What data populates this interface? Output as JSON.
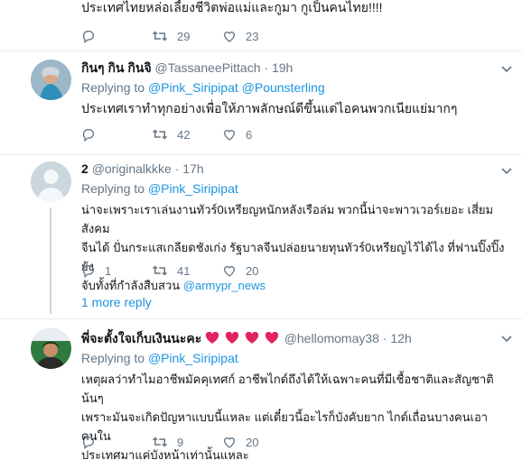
{
  "tweets": [
    {
      "text": "ประเทศไทยหล่อเลี้ยงชีวิตพ่อแม่และกูมา กูเป็นคนไทย!!!!",
      "retweets": "29",
      "likes": "23"
    },
    {
      "name": "กินๆ กิน กินจิ",
      "handle": "@TassaneePittach",
      "dot": "·",
      "time": "19h",
      "replying_label": "Replying to",
      "mention1": "@Pink_Siripipat",
      "mention2": "@Pounsterling",
      "text": "ประเทศเราทำทุกอย่างเพื่อให้ภาพลักษณ์ดีขึ้นแต่ไอคนพวกเนียแย่มากๆ",
      "retweets": "42",
      "likes": "6"
    },
    {
      "name": "2",
      "handle": "@originalkkke",
      "dot": "·",
      "time": "17h",
      "replying_label": "Replying to",
      "mention1": "@Pink_Siripipat",
      "text_line1": "น่าจะเพราะเราเล่นงานทัวร์0เหรียญหนักหลังเรือล่ม พวกนี้น่าจะพาวเวอร์เยอะ เสี่ยมสังคม",
      "text_line2": "จีนได้ ปั่นกระแสเกลียดชังเก่ง รัฐบาลจีนปล่อยนายทุนทัวร์0เหรียญไว้ได้ไง ที่ฟานปิ๊งปิ๊งยัง",
      "text_line3": "จับทั้งที่กำลังสืบสวน",
      "text_mention": "@armypr_news",
      "replies": "1",
      "retweets": "41",
      "likes": "20",
      "more_reply": "1 more reply"
    },
    {
      "name": "พี่จะตั้งใจเก็บเงินนะคะ",
      "handle": "@hellomomay38",
      "dot": "·",
      "time": "12h",
      "replying_label": "Replying to",
      "mention1": "@Pink_Siripipat",
      "text_line1": "เหตุผลว่าทำไมอาชีพมัคคุเทศก์ อาชีพไกด์ถึงได้ให้เฉพาะคนที่มีเชื้อชาติและสัญชาติน้นๆ",
      "text_line2": "เพราะมันจะเกิดปัญหาแบบนี้แหละ แต่เดี๋ยวนี้อะไรก็บังคับยาก ไกด์เถื่อนบางคนเอาคนใน",
      "text_line3": "ประเทศมาแค่บังหน้าเท่านั้นแหละ",
      "retweets": "9",
      "likes": "20"
    }
  ],
  "colors": {
    "link": "#1b95e0",
    "muted": "#657786",
    "divider": "#e6ecf0",
    "heart_emoji": "#e0245e"
  },
  "icons": [
    "reply-icon",
    "retweet-icon",
    "like-icon",
    "caret-down-icon",
    "heart-emoji-icon",
    "avatar"
  ]
}
